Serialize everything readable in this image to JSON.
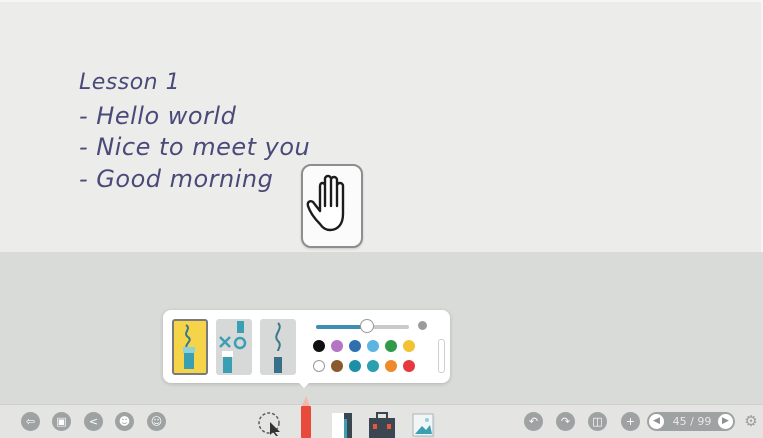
{
  "board": {
    "lines": [
      "Lesson 1",
      "- Hello world",
      "- Nice to meet you",
      "- Good morning"
    ]
  },
  "pen_popup": {
    "pen_types": [
      "highlighter-pen-icon",
      "marker-pen-icon",
      "brush-pen-icon"
    ],
    "selected_pen": 0,
    "stroke_size": 0.55,
    "colors": [
      "#111111",
      "#b574c4",
      "#2e6fb0",
      "#5bb5e0",
      "#2f9a4a",
      "#f2c233",
      "#ffffff",
      "#8a5a2e",
      "#1e8fa8",
      "#2a9fb0",
      "#ef8a2a",
      "#e5383f"
    ]
  },
  "toolbar": {
    "left_icons": [
      "exit-icon",
      "save-icon",
      "share-icon",
      "add-user-icon",
      "account-settings-icon"
    ],
    "center_icons": [
      "select-icon",
      "pen-icon",
      "eraser-icon",
      "toolbox-icon",
      "insert-image-icon"
    ],
    "right_icons": [
      "undo-icon",
      "redo-icon",
      "page-view-icon",
      "add-page-icon"
    ],
    "page_current": "45",
    "page_total": "99",
    "page_label": "45 / 99",
    "accent": "#e84a3c"
  }
}
